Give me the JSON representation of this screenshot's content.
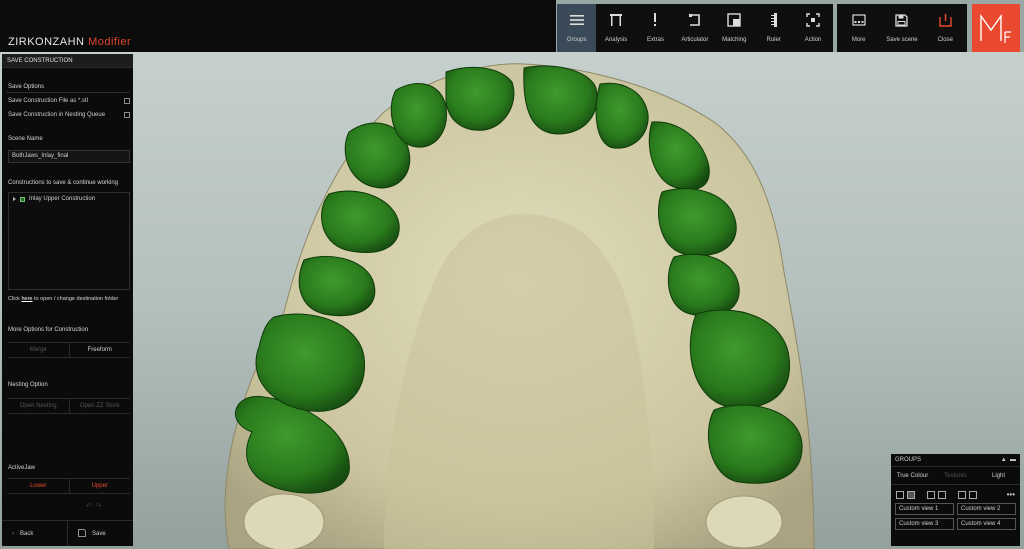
{
  "app": {
    "name": "ZIRKONZAHN",
    "module": "Modifier"
  },
  "toolbar": [
    {
      "id": "groups",
      "label": "Groups",
      "icon": "menu-icon",
      "active": true
    },
    {
      "id": "analysis",
      "label": "Analysis",
      "icon": "analysis-icon",
      "active": false
    },
    {
      "id": "extras",
      "label": "Extras",
      "icon": "exclamation-icon",
      "active": false
    },
    {
      "id": "articulator",
      "label": "Articulator",
      "icon": "articulator-icon",
      "active": false
    },
    {
      "id": "matching",
      "label": "Matching",
      "icon": "matching-icon",
      "active": false
    },
    {
      "id": "ruler",
      "label": "Ruler",
      "icon": "ruler-icon",
      "active": false
    },
    {
      "id": "action",
      "label": "Action",
      "icon": "action-icon",
      "active": false
    }
  ],
  "toolbar_right": [
    {
      "id": "more",
      "label": "More",
      "icon": "more-icon"
    },
    {
      "id": "save_scene",
      "label": "Save scene",
      "icon": "floppy-icon"
    },
    {
      "id": "close",
      "label": "Close",
      "icon": "close-icon"
    }
  ],
  "logo": {
    "main": "M",
    "sub": "F",
    "color": "#e94a2f"
  },
  "panel": {
    "header": "SAVE CONSTRUCTION",
    "save_options": "Save Options",
    "opt_stl": "Save Construction File as *.stl",
    "opt_nesting": "Save Construction in Nesting Queue",
    "scene_name_label": "Scene Name",
    "scene_name_value": "BothJaws_Inlay_final",
    "constructions_label": "Constructions to save & continue working",
    "construction_item": "Inlay Upper Construction",
    "click_prefix": "Click ",
    "click_link": "here",
    "click_suffix": " to open / change destination folder",
    "more_options": "More Options for Construction",
    "merge": "Merge",
    "freeform": "Freeform",
    "nesting_option": "Nesting Option",
    "open_nesting": "Open Nesting",
    "open_zz_store": "Open ZZ Store",
    "active_jaw": "ActiveJaw",
    "lower": "Lower",
    "upper": "Upper",
    "back": "Back",
    "save": "Save"
  },
  "groups_panel": {
    "title": "GROUPS",
    "tab_true_colour": "True Colour",
    "tab_textures": "Textures",
    "tab_light": "Light",
    "custom_view_1": "Custom view 1",
    "custom_view_2": "Custom view 2",
    "custom_view_3": "Custom view 3",
    "custom_view_4": "Custom view 4"
  },
  "colors": {
    "accent": "#e94a2f",
    "tooth_green": "#2d7a1f",
    "model_cream": "#d6d2ad",
    "active_tab": "#3a4a58"
  }
}
